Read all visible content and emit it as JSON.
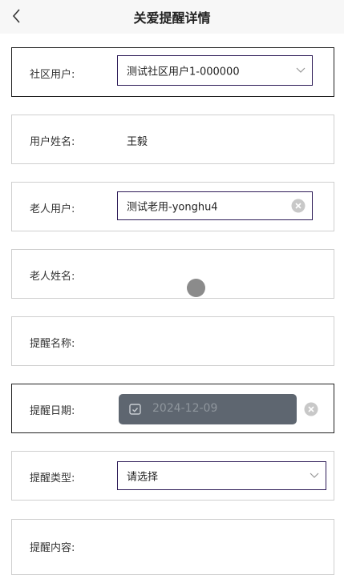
{
  "header": {
    "title": "关爱提醒详情",
    "back_icon": "chevron-left-icon"
  },
  "community_user": {
    "label": "社区用户:",
    "value": "测试社区用户1-000000"
  },
  "user_name": {
    "label": "用户姓名:",
    "value": "王毅"
  },
  "elder_user": {
    "label": "老人用户:",
    "value": "测试老用-yonghu4"
  },
  "elder_name": {
    "label": "老人姓名:"
  },
  "reminder_name": {
    "label": "提醒名称:"
  },
  "reminder_date": {
    "label": "提醒日期:",
    "value": "2024-12-09"
  },
  "reminder_type": {
    "label": "提醒类型:",
    "placeholder": "请选择"
  },
  "reminder_content": {
    "label": "提醒内容:"
  },
  "colors": {
    "accent_border": "#2d1b57",
    "date_chip_bg": "#5e6670"
  }
}
